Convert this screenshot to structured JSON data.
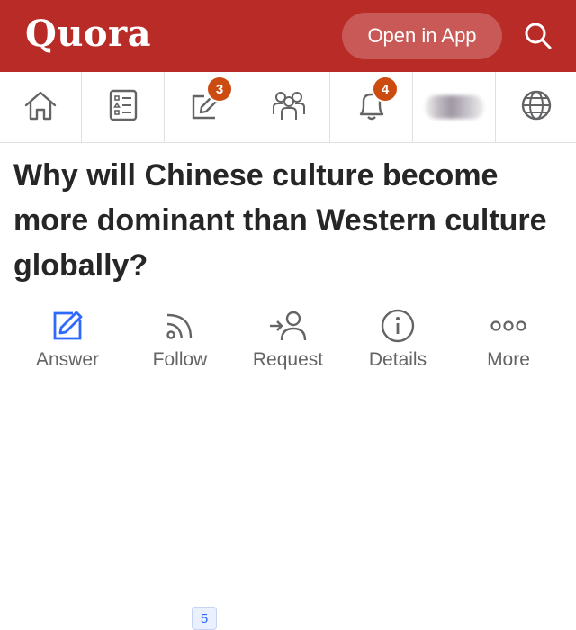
{
  "header": {
    "logo": "Quora",
    "open_app_label": "Open in App",
    "brand_color": "#b92b27"
  },
  "nav": {
    "items": [
      {
        "name": "home",
        "icon": "home-icon"
      },
      {
        "name": "answer-list",
        "icon": "list-icon"
      },
      {
        "name": "answer",
        "icon": "edit-icon",
        "badge": "3"
      },
      {
        "name": "spaces",
        "icon": "people-icon"
      },
      {
        "name": "notifications",
        "icon": "bell-icon",
        "badge": "4"
      },
      {
        "name": "profile",
        "icon": "avatar"
      },
      {
        "name": "language",
        "icon": "globe-icon"
      }
    ]
  },
  "question": {
    "title": "Why will Chinese culture become more dominant than Western culture globally?"
  },
  "actions": {
    "answer": "Answer",
    "follow": "Follow",
    "follow_count": "5",
    "request": "Request",
    "details": "Details",
    "more": "More",
    "accent_color": "#2e69ff"
  }
}
